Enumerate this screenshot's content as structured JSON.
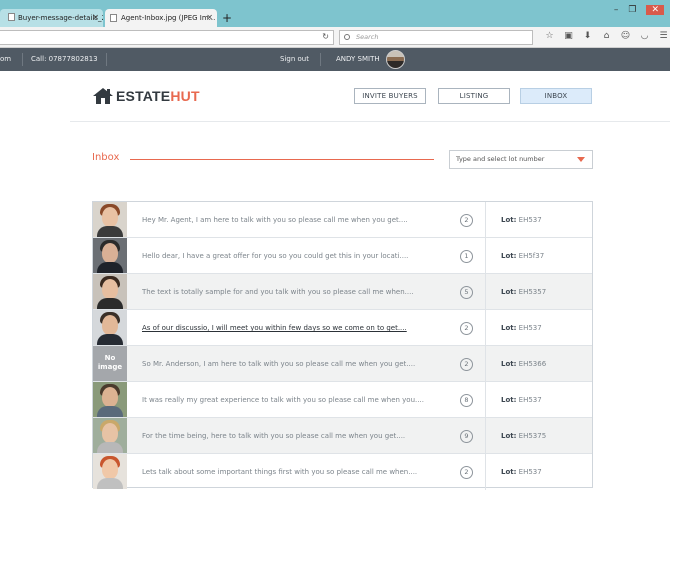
{
  "browser": {
    "tabs": [
      {
        "title": "Buyer-message-details_26..."
      },
      {
        "title": "Agent-Inbox.jpg (JPEG Im..."
      }
    ],
    "search_placeholder": "Search"
  },
  "topbar": {
    "site_fragment": "om",
    "phone": "Call: 07877802813",
    "sign_out": "Sign out",
    "user_name": "ANDY SMITH"
  },
  "header": {
    "logo_part1": "ESTATE",
    "logo_part2": "HUT",
    "nav": {
      "invite": "INVITE BUYERS",
      "listing": "LISTING",
      "inbox": "INBOX"
    }
  },
  "inbox": {
    "title": "Inbox",
    "lot_select_placeholder": "Type and select  lot number",
    "lot_label": "Lot:",
    "messages": [
      {
        "text": "Hey Mr. Agent, I am here to talk with you so please call me when you get....",
        "count": "2",
        "lot": "EH537",
        "avatar": "woman-auburn-hair"
      },
      {
        "text": "Hello dear, I have a great offer for you so you could get this in your locati....",
        "count": "1",
        "lot": "EH5f37",
        "avatar": "man-glasses-suit"
      },
      {
        "text": "The text is totally sample for and you talk with you so please call me when....",
        "count": "5",
        "lot": "EH5357",
        "avatar": "woman-dark-hair"
      },
      {
        "text": "As of our discussio, I will meet you within few days so we come on to get....",
        "count": "2",
        "lot": "EH537",
        "avatar": "man-suit-smiling"
      },
      {
        "text": "So Mr. Anderson, I am here to talk with you so please call me when you get....",
        "count": "2",
        "lot": "EH5366",
        "avatar": "no-image",
        "no_image_text_1": "No",
        "no_image_text_2": "image"
      },
      {
        "text": "It was really my great experience to talk with you so please call me when you....",
        "count": "8",
        "lot": "EH537",
        "avatar": "man-casual-outdoor"
      },
      {
        "text": "For the time being, here to talk with you so please call me when you get....",
        "count": "9",
        "lot": "EH5375",
        "avatar": "man-blond-outdoor"
      },
      {
        "text": "Lets talk about some important things first with you so please call me when....",
        "count": "2",
        "lot": "EH537",
        "avatar": "woman-red-hair"
      }
    ]
  },
  "colors": {
    "accent": "#e8694f",
    "topbar": "#505a64",
    "tabbar": "#7ec4ce",
    "inbox_active": "#dcebfa"
  }
}
